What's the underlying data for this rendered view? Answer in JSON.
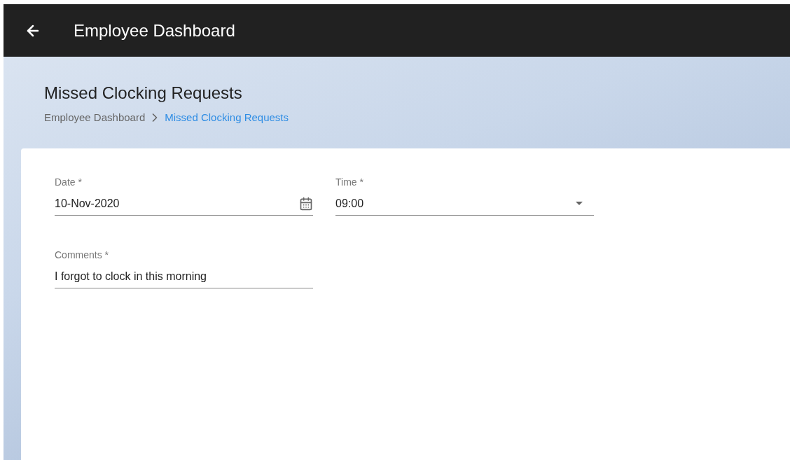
{
  "app_bar": {
    "title": "Employee Dashboard"
  },
  "page": {
    "title": "Missed Clocking Requests",
    "breadcrumb": [
      {
        "label": "Employee Dashboard",
        "current": false
      },
      {
        "label": "Missed Clocking Requests",
        "current": true
      }
    ]
  },
  "form": {
    "rows": [
      [
        {
          "kind": "date",
          "label": "Date *",
          "value": "10-Nov-2020"
        },
        {
          "kind": "select",
          "label": "Time *",
          "value": "09:00"
        }
      ],
      [
        {
          "kind": "text",
          "label": "Comments *",
          "value": "I forgot to clock in this morning"
        }
      ]
    ]
  }
}
